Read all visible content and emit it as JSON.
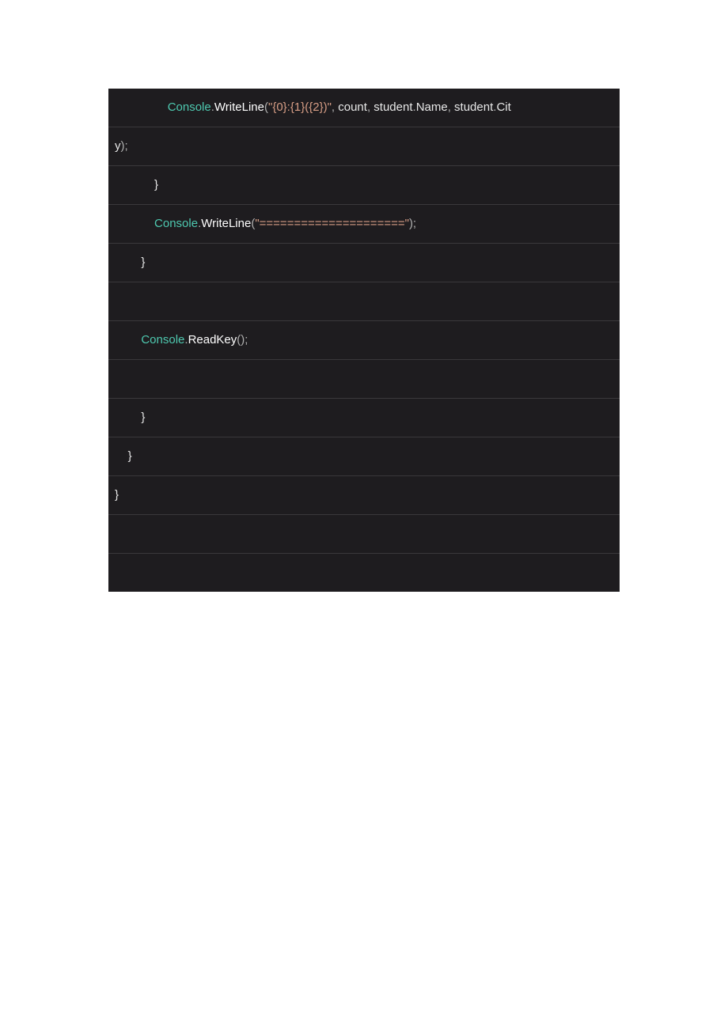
{
  "code": {
    "lines": [
      {
        "indent": "                ",
        "tokens": [
          {
            "t": "Console",
            "c": "tok-class"
          },
          {
            "t": ".",
            "c": "tok-punct"
          },
          {
            "t": "WriteLine",
            "c": "tok-method"
          },
          {
            "t": "(",
            "c": "tok-punct"
          },
          {
            "t": "\"{0}:{1}({2})\"",
            "c": "tok-string"
          },
          {
            "t": ", ",
            "c": "tok-punct"
          },
          {
            "t": "count",
            "c": "tok-text"
          },
          {
            "t": ", ",
            "c": "tok-punct"
          },
          {
            "t": "student",
            "c": "tok-text"
          },
          {
            "t": ".",
            "c": "tok-punct"
          },
          {
            "t": "Name",
            "c": "tok-text"
          },
          {
            "t": ", ",
            "c": "tok-punct"
          },
          {
            "t": "student",
            "c": "tok-text"
          },
          {
            "t": ".",
            "c": "tok-punct"
          },
          {
            "t": "Cit",
            "c": "tok-text"
          }
        ]
      },
      {
        "indent": "",
        "tokens": [
          {
            "t": "y",
            "c": "tok-text"
          },
          {
            "t": ");",
            "c": "tok-punct"
          }
        ]
      },
      {
        "indent": "            ",
        "tokens": [
          {
            "t": "}",
            "c": "tok-text"
          }
        ]
      },
      {
        "indent": "            ",
        "tokens": [
          {
            "t": "Console",
            "c": "tok-class"
          },
          {
            "t": ".",
            "c": "tok-punct"
          },
          {
            "t": "WriteLine",
            "c": "tok-method"
          },
          {
            "t": "(",
            "c": "tok-punct"
          },
          {
            "t": "\"=====================\"",
            "c": "tok-string"
          },
          {
            "t": ");",
            "c": "tok-punct"
          }
        ]
      },
      {
        "indent": "        ",
        "tokens": [
          {
            "t": "}",
            "c": "tok-text"
          }
        ]
      },
      {
        "indent": "",
        "tokens": [
          {
            "t": " ",
            "c": "tok-text"
          }
        ]
      },
      {
        "indent": "        ",
        "tokens": [
          {
            "t": "Console",
            "c": "tok-class"
          },
          {
            "t": ".",
            "c": "tok-punct"
          },
          {
            "t": "ReadKey",
            "c": "tok-method"
          },
          {
            "t": "();",
            "c": "tok-punct"
          }
        ]
      },
      {
        "indent": "",
        "tokens": [
          {
            "t": " ",
            "c": "tok-text"
          }
        ]
      },
      {
        "indent": "        ",
        "tokens": [
          {
            "t": "}",
            "c": "tok-text"
          }
        ]
      },
      {
        "indent": "    ",
        "tokens": [
          {
            "t": "}",
            "c": "tok-text"
          }
        ]
      },
      {
        "indent": "",
        "tokens": [
          {
            "t": "}",
            "c": "tok-text"
          }
        ]
      },
      {
        "indent": "",
        "tokens": [
          {
            "t": " ",
            "c": "tok-text"
          }
        ]
      },
      {
        "indent": "",
        "tokens": [
          {
            "t": " ",
            "c": "tok-text"
          }
        ]
      }
    ]
  }
}
